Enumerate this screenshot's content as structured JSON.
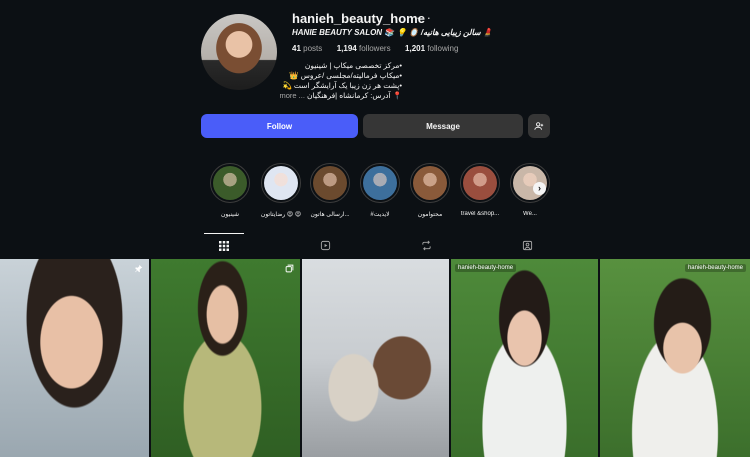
{
  "profile": {
    "username": "hanieh_beauty_home",
    "more": "···",
    "category_line": "HANIE BEAUTY SALON 📚 💡 🪞 /سالن زیبایی هانیه 💄",
    "stats": {
      "posts": "41",
      "posts_label": "posts",
      "followers": "1,194",
      "followers_label": "followers",
      "following": "1,201",
      "following_label": "following"
    },
    "bio": [
      "•مرکز تخصصی میکاپ | شینیون",
      "•میکاپ فرمالیته/مجلسی /عروس 👑",
      "•پشت هر زن زیبا یک آرایشگر است 💫",
      "📍 آدرس: کرمانشاه |فرهنگیان"
    ],
    "bio_more": "... more"
  },
  "actions": {
    "follow": "Follow",
    "message": "Message",
    "add_user_icon": "add-user-icon"
  },
  "highlights": [
    {
      "label": "شینیون",
      "color": "#3b5b2a"
    },
    {
      "label": "رضایتاتون 😍 😍",
      "color": "#dfe6f2"
    },
    {
      "label": "ارسالی هاتون...",
      "color": "#6b4a2e"
    },
    {
      "label": "#لایدیت",
      "color": "#3d6f9c"
    },
    {
      "label": "محتوامون",
      "color": "#8a5a3a"
    },
    {
      "label": "travel &shop...",
      "color": "#9a4e3e"
    },
    {
      "label": "We...",
      "color": "#c9b7a8"
    }
  ],
  "tabs": [
    {
      "name": "posts-grid-icon",
      "active": true
    },
    {
      "name": "reels-icon",
      "active": false
    },
    {
      "name": "reposts-icon",
      "active": false
    },
    {
      "name": "tagged-icon",
      "active": false
    }
  ],
  "posts": [
    {
      "tag": "",
      "badge": "pin-icon"
    },
    {
      "tag": "",
      "badge": "carousel-icon"
    },
    {
      "tag": "",
      "badge": ""
    },
    {
      "tag": "hanieh-beauty-home",
      "badge": ""
    },
    {
      "tag": "hanieh-beauty-home",
      "badge": ""
    }
  ]
}
